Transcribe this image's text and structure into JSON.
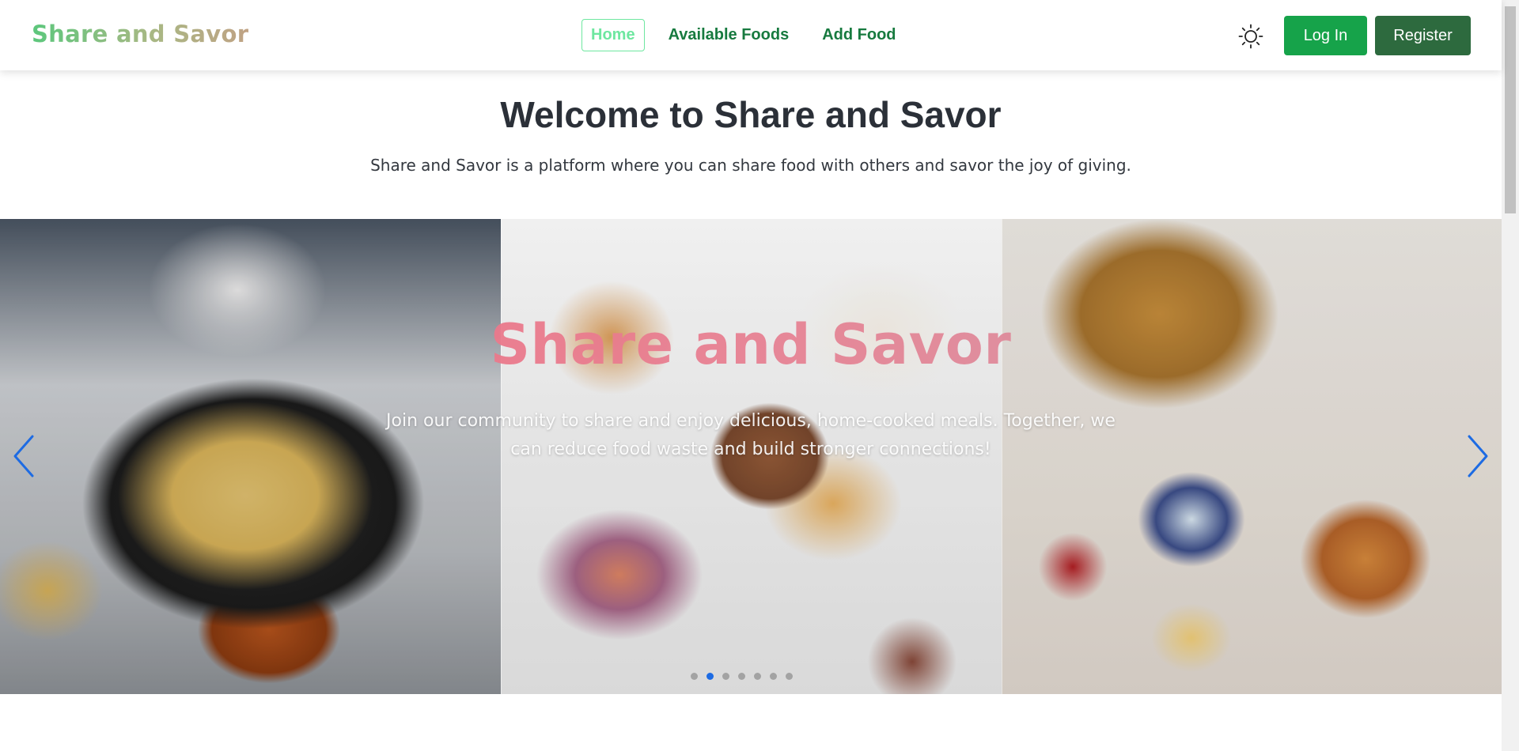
{
  "navbar": {
    "brand": "Share and Savor",
    "links": [
      {
        "label": "Home",
        "active": true
      },
      {
        "label": "Available Foods",
        "active": false
      },
      {
        "label": "Add Food",
        "active": false
      }
    ],
    "theme_toggle_icon": "sun-icon",
    "login_label": "Log In",
    "register_label": "Register"
  },
  "hero": {
    "title": "Welcome to Share and Savor",
    "subtitle": "Share and Savor is a platform where you can share food with others and savor the joy of giving."
  },
  "carousel": {
    "title": "Share and Savor",
    "text": "Join our community to share and enjoy delicious, home-cooked meals. Together, we can reduce food waste and build stronger connections!",
    "slides": [
      {
        "image": "ramen-bowl-with-side-dishes"
      },
      {
        "image": "breakfast-bowls-waffles-and-coffee"
      },
      {
        "image": "eggs-on-toast-waffles-and-strawberries"
      }
    ],
    "prev_icon": "chevron-left-icon",
    "next_icon": "chevron-right-icon",
    "dot_count": 7,
    "active_dot": 1
  },
  "colors": {
    "brand_green": "#16a34a",
    "register_green": "#2d6a3e",
    "link_green": "#177a3f",
    "active_link": "#6ee7a0",
    "carousel_title": "#f36b7f",
    "arrow_blue": "#1d6be3"
  }
}
